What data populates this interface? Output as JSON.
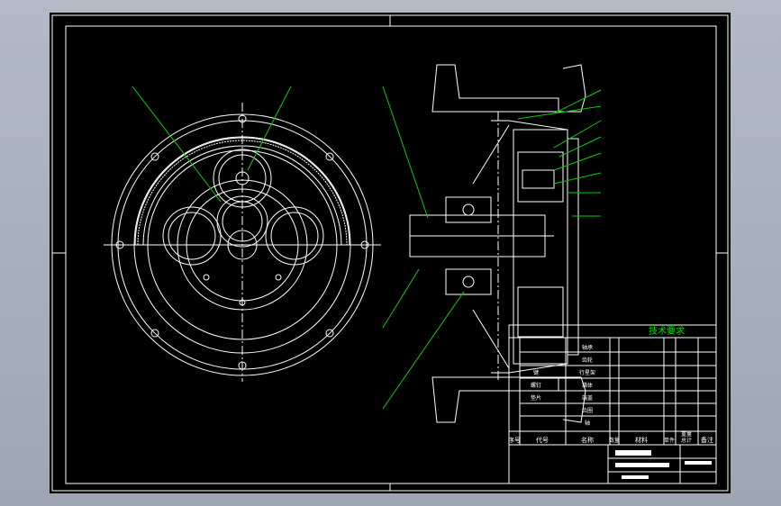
{
  "drawing": {
    "tech_req_title": "技术要求",
    "title_block": {
      "col_index": "序号",
      "col_code": "代号",
      "col_name": "名称",
      "col_qty": "数量",
      "col_material": "材料",
      "col_unit": "单件",
      "col_total": "总计",
      "col_weight": "重量",
      "col_remark": "备注"
    },
    "rows": [
      {
        "name": "轴承"
      },
      {
        "name": "齿轮"
      },
      {
        "name": "行星架"
      },
      {
        "name": "箱体"
      },
      {
        "name": "端盖"
      },
      {
        "name": "齿圈"
      },
      {
        "name": "轴"
      },
      {
        "name": "键"
      },
      {
        "name": "螺钉"
      },
      {
        "name": "垫片"
      }
    ]
  },
  "colors": {
    "background": "#000000",
    "line": "#ffffff",
    "leader": "#00d000",
    "desktop": "#a9b0bd"
  }
}
